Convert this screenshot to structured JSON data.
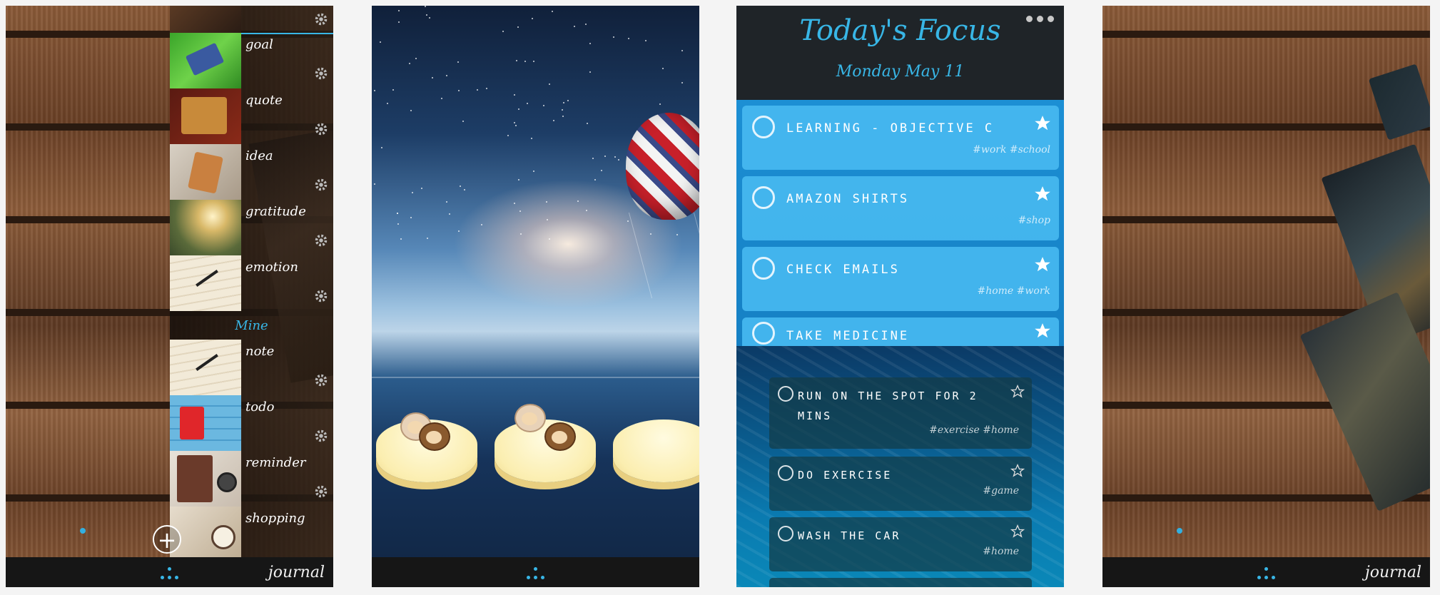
{
  "colors": {
    "accent": "#38b6e6",
    "bottom_bar": "#161616",
    "focus_card": "#46b9f0",
    "wood": "#7a4c30"
  },
  "screen1": {
    "journal_label": "journal",
    "add_icon": "plus-circle-icon",
    "rows": [
      {
        "label": "goal",
        "thumb": "notebook-on-grass"
      },
      {
        "label": "quote",
        "thumb": "leather-notebook-red"
      },
      {
        "label": "idea",
        "thumb": "notebook-with-pencil"
      },
      {
        "label": "gratitude",
        "thumb": "forest-sunlight"
      },
      {
        "label": "emotion",
        "thumb": "paper-and-pen"
      }
    ],
    "section_title": "Mine",
    "mine_rows": [
      {
        "label": "note",
        "thumb": "paper-and-pen"
      },
      {
        "label": "todo",
        "thumb": "red-notebook-blue-wood"
      },
      {
        "label": "reminder",
        "thumb": "notebook-and-watch"
      },
      {
        "label": "shopping",
        "thumb": "desk-with-clock"
      }
    ]
  },
  "screen2": {
    "scene": "starry-sky-sea-hot-air-balloon",
    "characters": [
      "cat",
      "monkey",
      "cat",
      "monkey"
    ]
  },
  "screen3": {
    "title": "Today's Focus",
    "date": "Monday May 11",
    "focus_items": [
      {
        "text": "Learning - Objective C",
        "tags": "#work #school"
      },
      {
        "text": "Amazon shirts",
        "tags": "#shop"
      },
      {
        "text": "Check emails",
        "tags": "#home #work"
      },
      {
        "text": "Take medicine",
        "tags": ""
      }
    ],
    "tasks": [
      {
        "text": "Run on the spot for 2 mins",
        "tags": "#exercise #home"
      },
      {
        "text": "Do exercise",
        "tags": "#game"
      },
      {
        "text": "Wash the car",
        "tags": "#home"
      }
    ]
  },
  "screen4": {
    "journal_label": "journal",
    "scene": "wood-table-with-old-books"
  }
}
